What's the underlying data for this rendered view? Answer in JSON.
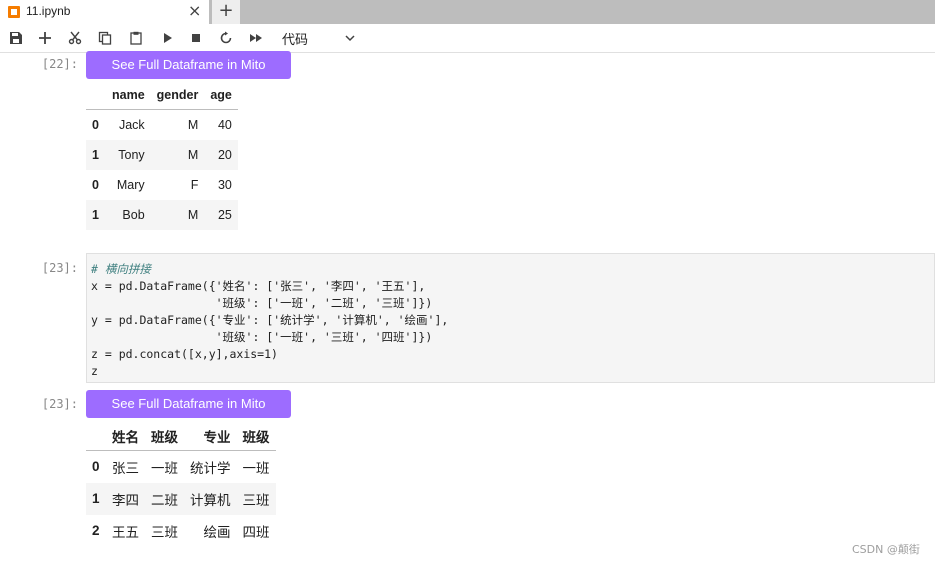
{
  "tab": {
    "title": "11.ipynb",
    "close_icon": "×",
    "new_icon": "+"
  },
  "toolbar": {
    "buttons": [
      "save-icon",
      "add-cell-icon",
      "cut-icon",
      "copy-icon",
      "paste-icon",
      "run-icon",
      "stop-icon",
      "restart-icon",
      "fast-forward-icon"
    ],
    "cell_type": "代码"
  },
  "cells": {
    "out22": {
      "prompt": "[22]:",
      "mito_label": "See Full Dataframe in Mito",
      "columns": [
        "name",
        "gender",
        "age"
      ],
      "rows": [
        {
          "index": "0",
          "values": [
            "Jack",
            "M",
            "40"
          ]
        },
        {
          "index": "1",
          "values": [
            "Tony",
            "M",
            "20"
          ]
        },
        {
          "index": "0",
          "values": [
            "Mary",
            "F",
            "30"
          ]
        },
        {
          "index": "1",
          "values": [
            "Bob",
            "M",
            "25"
          ]
        }
      ]
    },
    "in23": {
      "prompt": "[23]:",
      "lines": [
        "# 横向拼接",
        "x = pd.DataFrame({'姓名': ['张三', '李四', '王五'],",
        "                  '班级': ['一班', '二班', '三班']})",
        "y = pd.DataFrame({'专业': ['统计学', '计算机', '绘画'],",
        "                  '班级': ['一班', '三班', '四班']})",
        "z = pd.concat([x,y],axis=1)",
        "z"
      ]
    },
    "out23": {
      "prompt": "[23]:",
      "mito_label": "See Full Dataframe in Mito",
      "columns": [
        "姓名",
        "班级",
        "专业",
        "班级"
      ],
      "rows": [
        {
          "index": "0",
          "values": [
            "张三",
            "一班",
            "统计学",
            "一班"
          ]
        },
        {
          "index": "1",
          "values": [
            "李四",
            "二班",
            "计算机",
            "三班"
          ]
        },
        {
          "index": "2",
          "values": [
            "王五",
            "三班",
            "绘画",
            "四班"
          ]
        }
      ]
    }
  },
  "watermark": "CSDN @颠街",
  "colors": {
    "mito": "#9d6cff",
    "code_bg": "#f5f5f5",
    "tab_icon": "#f57c00"
  }
}
